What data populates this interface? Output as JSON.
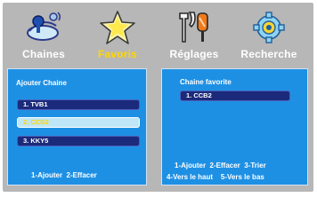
{
  "menu": {
    "tabs": [
      {
        "id": "chaines",
        "label": "Chaines",
        "icon": "satellite-icon",
        "active": false
      },
      {
        "id": "favoris",
        "label": "Favoris",
        "icon": "star-icon",
        "active": true
      },
      {
        "id": "reglages",
        "label": "Réglages",
        "icon": "tools-icon",
        "active": false
      },
      {
        "id": "recherche",
        "label": "Recherche",
        "icon": "search-gear-icon",
        "active": false
      }
    ]
  },
  "left_panel": {
    "title": "Ajouter Chaine",
    "items": [
      {
        "label": "1. TVB1",
        "selected": false
      },
      {
        "label": "2. CCB2",
        "selected": true
      },
      {
        "label": "3. KKY5",
        "selected": false
      }
    ],
    "help": "1-Ajouter  2-Effacer"
  },
  "right_panel": {
    "title": "Chaine favorite",
    "items": [
      {
        "label": "1. CCB2",
        "selected": false
      }
    ],
    "help_line1": "1-Ajouter  2-Effacer  3-Trier",
    "help_line2": "4-Vers le haut    5-Vers le bas"
  },
  "colors": {
    "background": "#b7b7b7",
    "panel": "#1e90e4",
    "item": "#1b2a7a",
    "item_selected": "#bfe6f7",
    "active_text": "#ffd600"
  }
}
